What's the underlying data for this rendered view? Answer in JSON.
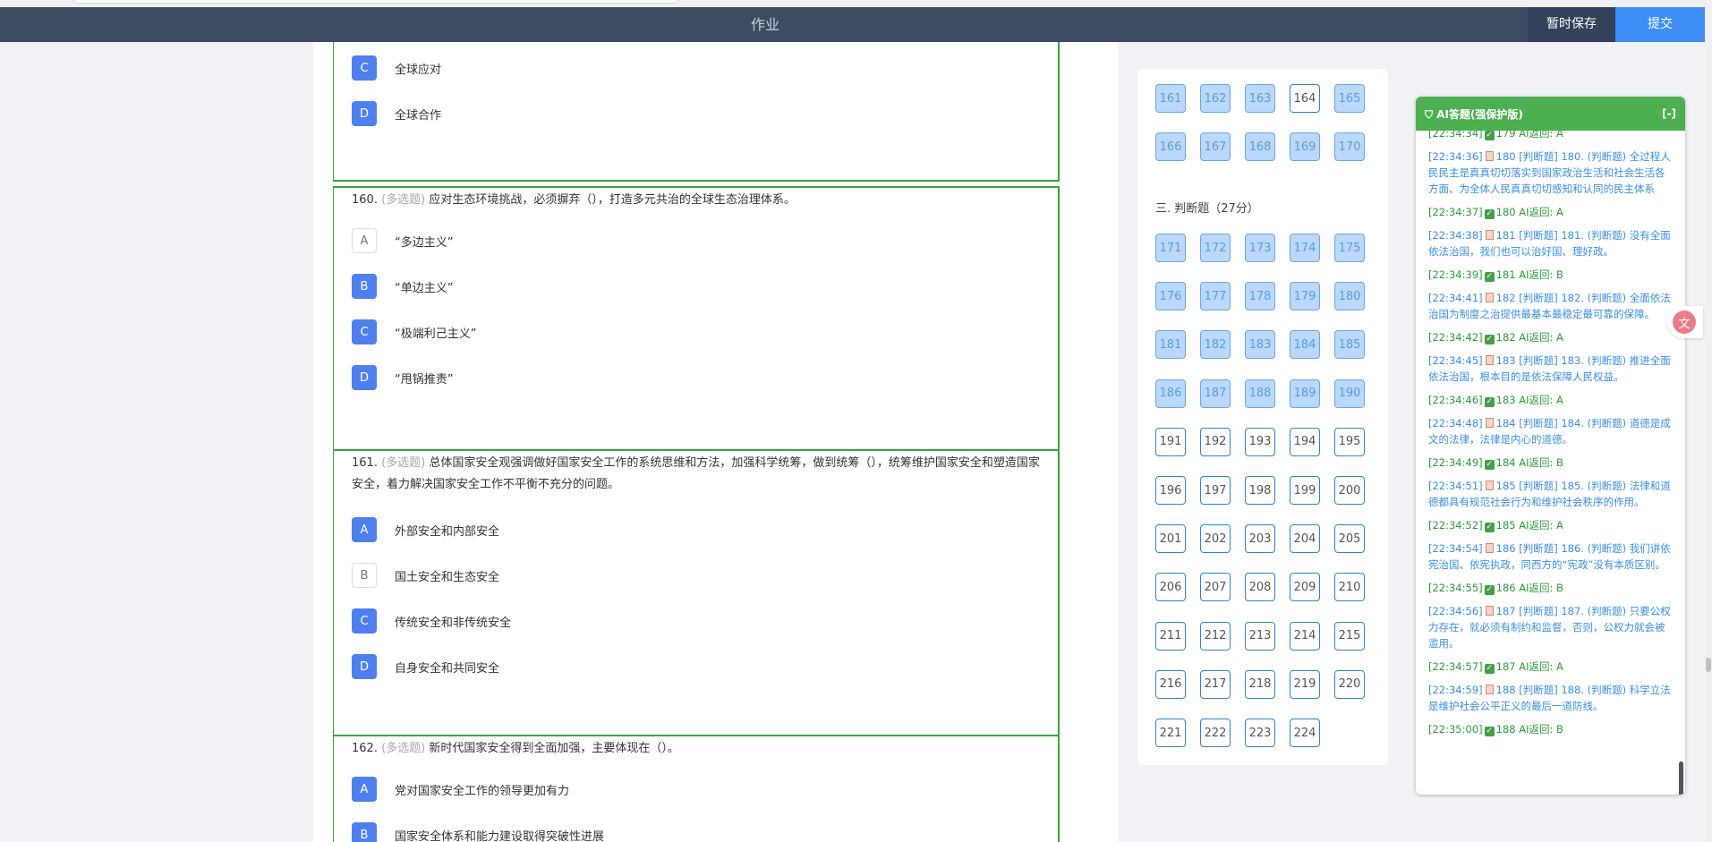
{
  "header": {
    "title": "作业",
    "save_label": "暂时保存",
    "submit_label": "提交"
  },
  "questions": [
    {
      "text": "",
      "type": "",
      "options": [
        {
          "letter": "C",
          "text": "全球应对",
          "selected": true
        },
        {
          "letter": "D",
          "text": "全球合作",
          "selected": true
        }
      ]
    },
    {
      "number": "160.",
      "type": "(多选题)",
      "text": "应对生态环境挑战，必须摒弃（），打造多元共治的全球生态治理体系。",
      "options": [
        {
          "letter": "A",
          "text": "“多边主义”",
          "selected": false
        },
        {
          "letter": "B",
          "text": "“单边主义”",
          "selected": true
        },
        {
          "letter": "C",
          "text": "“极端利己主义”",
          "selected": true
        },
        {
          "letter": "D",
          "text": "“甩锅推责”",
          "selected": true
        }
      ]
    },
    {
      "number": "161.",
      "type": "(多选题)",
      "text": "总体国家安全观强调做好国家安全工作的系统思维和方法，加强科学统筹，做到统筹（），统筹维护国家安全和塑造国家安全，着力解决国家安全工作不平衡不充分的问题。",
      "options": [
        {
          "letter": "A",
          "text": "外部安全和内部安全",
          "selected": true
        },
        {
          "letter": "B",
          "text": "国土安全和生态安全",
          "selected": false
        },
        {
          "letter": "C",
          "text": "传统安全和非传统安全",
          "selected": true
        },
        {
          "letter": "D",
          "text": "自身安全和共同安全",
          "selected": true
        }
      ]
    },
    {
      "number": "162.",
      "type": "(多选题)",
      "text": "新时代国家安全得到全面加强，主要体现在（）。",
      "options": [
        {
          "letter": "A",
          "text": "党对国家安全工作的领导更加有力",
          "selected": true
        },
        {
          "letter": "B",
          "text": "国家安全体系和能力建设取得突破性进展",
          "selected": true
        }
      ]
    }
  ],
  "answer_card": {
    "section3_title": "三. 判断题（27分）",
    "group1": [
      {
        "n": "161",
        "done": true
      },
      {
        "n": "162",
        "done": true
      },
      {
        "n": "163",
        "done": true
      },
      {
        "n": "164",
        "done": false
      },
      {
        "n": "165",
        "done": true
      },
      {
        "n": "166",
        "done": true
      },
      {
        "n": "167",
        "done": true
      },
      {
        "n": "168",
        "done": true
      },
      {
        "n": "169",
        "done": true
      },
      {
        "n": "170",
        "done": true
      }
    ],
    "group2": [
      {
        "n": "171",
        "done": true
      },
      {
        "n": "172",
        "done": true
      },
      {
        "n": "173",
        "done": true
      },
      {
        "n": "174",
        "done": true
      },
      {
        "n": "175",
        "done": true
      },
      {
        "n": "176",
        "done": true
      },
      {
        "n": "177",
        "done": true
      },
      {
        "n": "178",
        "done": true
      },
      {
        "n": "179",
        "done": true
      },
      {
        "n": "180",
        "done": true
      },
      {
        "n": "181",
        "done": true
      },
      {
        "n": "182",
        "done": true
      },
      {
        "n": "183",
        "done": true
      },
      {
        "n": "184",
        "done": true
      },
      {
        "n": "185",
        "done": true
      },
      {
        "n": "186",
        "done": true
      },
      {
        "n": "187",
        "done": true
      },
      {
        "n": "188",
        "done": true
      },
      {
        "n": "189",
        "done": true
      },
      {
        "n": "190",
        "done": true
      },
      {
        "n": "191",
        "done": false
      },
      {
        "n": "192",
        "done": false
      },
      {
        "n": "193",
        "done": false
      },
      {
        "n": "194",
        "done": false
      },
      {
        "n": "195",
        "done": false
      },
      {
        "n": "196",
        "done": false
      },
      {
        "n": "197",
        "done": false
      },
      {
        "n": "198",
        "done": false
      },
      {
        "n": "199",
        "done": false
      },
      {
        "n": "200",
        "done": false
      },
      {
        "n": "201",
        "done": false
      },
      {
        "n": "202",
        "done": false
      },
      {
        "n": "203",
        "done": false
      },
      {
        "n": "204",
        "done": false
      },
      {
        "n": "205",
        "done": false
      },
      {
        "n": "206",
        "done": false
      },
      {
        "n": "207",
        "done": false
      },
      {
        "n": "208",
        "done": false
      },
      {
        "n": "209",
        "done": false
      },
      {
        "n": "210",
        "done": false
      },
      {
        "n": "211",
        "done": false
      },
      {
        "n": "212",
        "done": false
      },
      {
        "n": "213",
        "done": false
      },
      {
        "n": "214",
        "done": false
      },
      {
        "n": "215",
        "done": false
      },
      {
        "n": "216",
        "done": false
      },
      {
        "n": "217",
        "done": false
      },
      {
        "n": "218",
        "done": false
      },
      {
        "n": "219",
        "done": false
      },
      {
        "n": "220",
        "done": false
      },
      {
        "n": "221",
        "done": false
      },
      {
        "n": "222",
        "done": false
      },
      {
        "n": "223",
        "done": false
      },
      {
        "n": "224",
        "done": false
      }
    ]
  },
  "ai_panel": {
    "title": "AI答题(强保护版)",
    "collapse_label": "[-]",
    "log": [
      {
        "kind": "r",
        "time": "[22:34:34]",
        "text": "179 AI返回: A"
      },
      {
        "kind": "q",
        "time": "[22:34:36]",
        "text": "180 [判断题] 180. (判断题) 全过程人民民主是真真切切落实到国家政治生活和社会生活各方面、为全体人民真真切切感知和认同的民主体系"
      },
      {
        "kind": "r",
        "time": "[22:34:37]",
        "text": "180 AI返回: A"
      },
      {
        "kind": "q",
        "time": "[22:34:38]",
        "text": "181 [判断题] 181. (判断题) 没有全面依法治国，我们也可以治好国、理好政。"
      },
      {
        "kind": "r",
        "time": "[22:34:39]",
        "text": "181 AI返回: B"
      },
      {
        "kind": "q",
        "time": "[22:34:41]",
        "text": "182 [判断题] 182. (判断题) 全面依法治国为制度之治提供最基本最稳定最可靠的保障。"
      },
      {
        "kind": "r",
        "time": "[22:34:42]",
        "text": "182 AI返回: A"
      },
      {
        "kind": "q",
        "time": "[22:34:45]",
        "text": "183 [判断题] 183. (判断题) 推进全面依法治国，根本目的是依法保障人民权益。"
      },
      {
        "kind": "r",
        "time": "[22:34:46]",
        "text": "183 AI返回: A"
      },
      {
        "kind": "q",
        "time": "[22:34:48]",
        "text": "184 [判断题] 184. (判断题) 道德是成文的法律，法律是内心的道德。"
      },
      {
        "kind": "r",
        "time": "[22:34:49]",
        "text": "184 AI返回: B"
      },
      {
        "kind": "q",
        "time": "[22:34:51]",
        "text": "185 [判断题] 185. (判断题) 法律和道德都具有规范社会行为和维护社会秩序的作用。"
      },
      {
        "kind": "r",
        "time": "[22:34:52]",
        "text": "185 AI返回: A"
      },
      {
        "kind": "q",
        "time": "[22:34:54]",
        "text": "186 [判断题] 186. (判断题) 我们讲依宪治国、依宪执政，同西方的“宪政”没有本质区别。"
      },
      {
        "kind": "r",
        "time": "[22:34:55]",
        "text": "186 AI返回: B"
      },
      {
        "kind": "q",
        "time": "[22:34:56]",
        "text": "187 [判断题] 187. (判断题) 只要公权力存在，就必须有制约和监督，否则，公权力就会被滥用。"
      },
      {
        "kind": "r",
        "time": "[22:34:57]",
        "text": "187 AI返回: A"
      },
      {
        "kind": "q",
        "time": "[22:34:59]",
        "text": "188 [判断题] 188. (判断题) 科学立法是维护社会公平正义的最后一道防线。"
      },
      {
        "kind": "r",
        "time": "[22:35:00]",
        "text": "188 AI返回: B"
      }
    ]
  },
  "floating": {
    "icon": "translate-icon",
    "glyph": "文"
  },
  "colors": {
    "header_bg": "#3d4c63",
    "submit_bg": "#3d8ff7",
    "selected_option": "#4e7fef",
    "question_border": "#3aa248",
    "ai_header": "#4caf50",
    "card_done_bg": "#b9d8fb"
  }
}
